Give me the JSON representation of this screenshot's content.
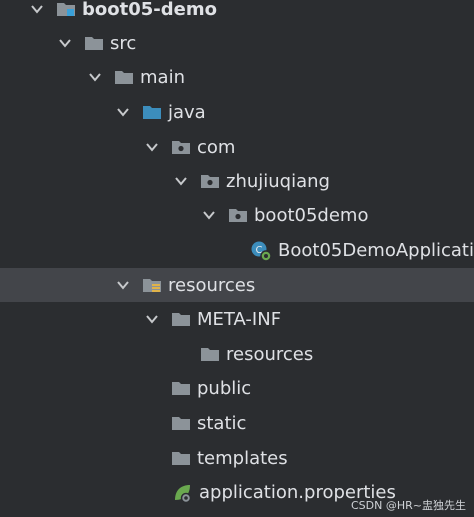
{
  "tree": {
    "root": "boot05-demo",
    "src": "src",
    "main": "main",
    "java": "java",
    "com": "com",
    "zhujiuqiang": "zhujiuqiang",
    "boot05demo": "boot05demo",
    "app_class": "Boot05DemoApplicati",
    "resources": "resources",
    "meta_inf": "META-INF",
    "meta_resources": "resources",
    "public": "public",
    "static": "static",
    "templates": "templates",
    "app_props": "application.properties"
  },
  "watermark": "CSDN @HR~盅独先生",
  "colors": {
    "background": "#2b2d30",
    "selected_row": "#43454a",
    "folder": "#8c9399",
    "source_folder": "#3c8dbc",
    "module_badge": "#3aa0d8",
    "spring_green": "#6aa84f"
  }
}
